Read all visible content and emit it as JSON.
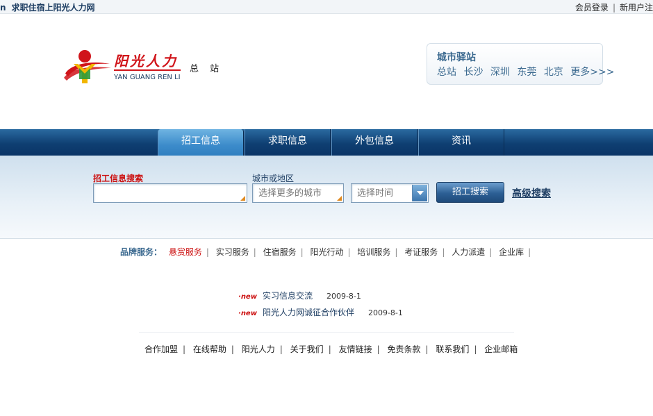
{
  "topbar": {
    "prefix": "n",
    "tagline": "求职住宿上阳光人力网",
    "links": [
      "会员登录",
      "新用户注"
    ]
  },
  "logo": {
    "brand_text": "阳光人力",
    "pinyin": "YAN GUANG REN LI",
    "colors": {
      "red": "#d0141a",
      "yellow": "#f2b600",
      "green": "#2e9a3a"
    }
  },
  "station_label": "总 站",
  "city_box": {
    "title": "城市驿站",
    "cities": [
      "总站",
      "长沙",
      "深圳",
      "东莞",
      "北京",
      "更多>>>"
    ]
  },
  "nav": {
    "tabs": [
      {
        "label": "招工信息",
        "active": true
      },
      {
        "label": "求职信息",
        "active": false
      },
      {
        "label": "外包信息",
        "active": false
      },
      {
        "label": "资讯",
        "active": false
      }
    ]
  },
  "search": {
    "job_label": "招工信息搜索",
    "job_value": "",
    "city_label": "城市或地区",
    "city_placeholder": "选择更多的城市",
    "time_placeholder": "选择时间",
    "button_label": "招工搜索",
    "advanced_label": "高级搜索"
  },
  "brand_services": {
    "label": "品牌服务：",
    "items": [
      "悬赏服务",
      "实习服务",
      "住宿服务",
      "阳光行动",
      "培训服务",
      "考证服务",
      "人力派遣",
      "企业库"
    ],
    "highlight_color": "#cc1111"
  },
  "news": [
    {
      "badge": "new",
      "title": "实习信息交流",
      "date": "2009-8-1"
    },
    {
      "badge": "new",
      "title": "阳光人力网诚征合作伙伴",
      "date": "2009-8-1"
    }
  ],
  "footer": {
    "links": [
      "合作加盟",
      "在线帮助",
      "阳光人力",
      "关于我们",
      "友情链接",
      "免责条款",
      "联系我们",
      "企业邮箱"
    ]
  }
}
